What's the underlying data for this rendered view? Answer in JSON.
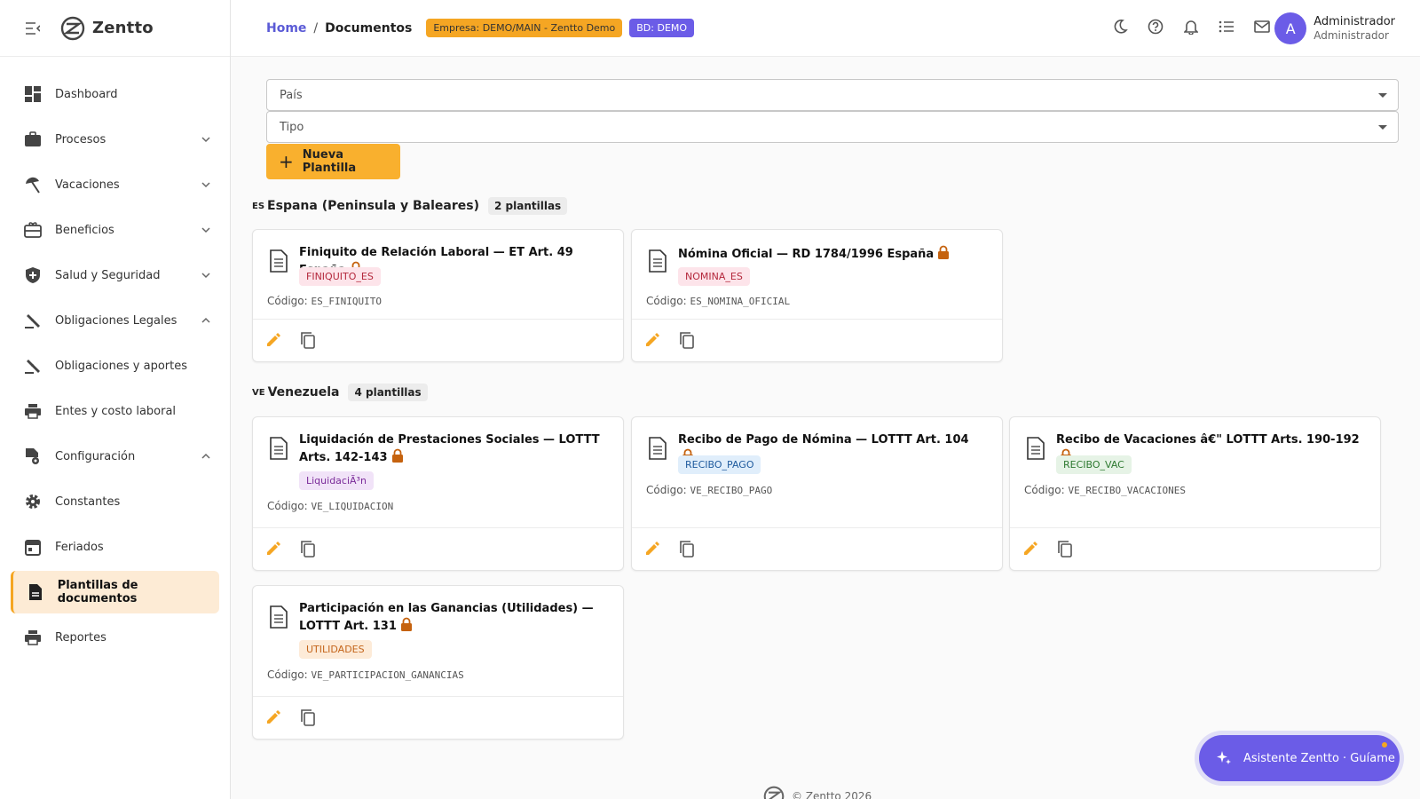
{
  "brand": {
    "name": "Zentto"
  },
  "sidebar": {
    "items": [
      {
        "label": "Dashboard"
      },
      {
        "label": "Procesos"
      },
      {
        "label": "Vacaciones"
      },
      {
        "label": "Beneficios"
      },
      {
        "label": "Salud y Seguridad"
      },
      {
        "label": "Obligaciones Legales"
      },
      {
        "label": "Obligaciones y aportes"
      },
      {
        "label": "Entes y costo laboral"
      },
      {
        "label": "Configuración"
      },
      {
        "label": "Constantes"
      },
      {
        "label": "Feriados"
      },
      {
        "label": "Plantillas de documentos"
      },
      {
        "label": "Reportes"
      }
    ]
  },
  "header": {
    "breadcrumb_home": "Home",
    "breadcrumb_sep": "/",
    "breadcrumb_current": "Documentos",
    "empresa_badge": "Empresa: DEMO/MAIN - Zentto Demo",
    "bd_badge": "BD: DEMO",
    "user_initial": "A",
    "user_name": "Administrador",
    "user_role": "Administrador"
  },
  "filters": {
    "country_placeholder": "País",
    "type_placeholder": "Tipo"
  },
  "new_button_label": "Nueva Plantilla",
  "groups": [
    {
      "flag": "ES",
      "name": "Espana (Peninsula y Baleares)",
      "count": "2 plantillas",
      "cards": [
        {
          "title": "Finiquito de Relación Laboral — ET Art. 49 España",
          "tag": "FINIQUITO_ES",
          "code_label": "Código:",
          "code": "ES_FINIQUITO"
        },
        {
          "title": "Nómina Oficial — RD 1784/1996 España",
          "tag": "NOMINA_ES",
          "code_label": "Código:",
          "code": "ES_NOMINA_OFICIAL"
        }
      ]
    },
    {
      "flag": "VE",
      "name": "Venezuela",
      "count": "4 plantillas",
      "cards": [
        {
          "title": "Liquidación de Prestaciones Sociales — LOTTT Arts. 142-143",
          "tag": "LiquidaciÃ³n",
          "code_label": "Código:",
          "code": "VE_LIQUIDACION"
        },
        {
          "title": "Recibo de Pago de Nómina — LOTTT Art. 104",
          "tag": "RECIBO_PAGO",
          "code_label": "Código:",
          "code": "VE_RECIBO_PAGO"
        },
        {
          "title": "Recibo de Vacaciones â€\" LOTTT Arts. 190-192",
          "tag": "RECIBO_VAC",
          "code_label": "Código:",
          "code": "VE_RECIBO_VACACIONES"
        },
        {
          "title": "Participación en las Ganancias (Utilidades) — LOTTT Art. 131",
          "tag": "UTILIDADES",
          "code_label": "Código:",
          "code": "VE_PARTICIPACION_GANANCIAS"
        }
      ]
    }
  ],
  "footer": {
    "text": "© Zentto 2026"
  },
  "assistant": {
    "label": "Asistente Zentto · Guíame"
  },
  "colors": {
    "accent": "#f5a623",
    "primary": "#6b5ce7"
  }
}
